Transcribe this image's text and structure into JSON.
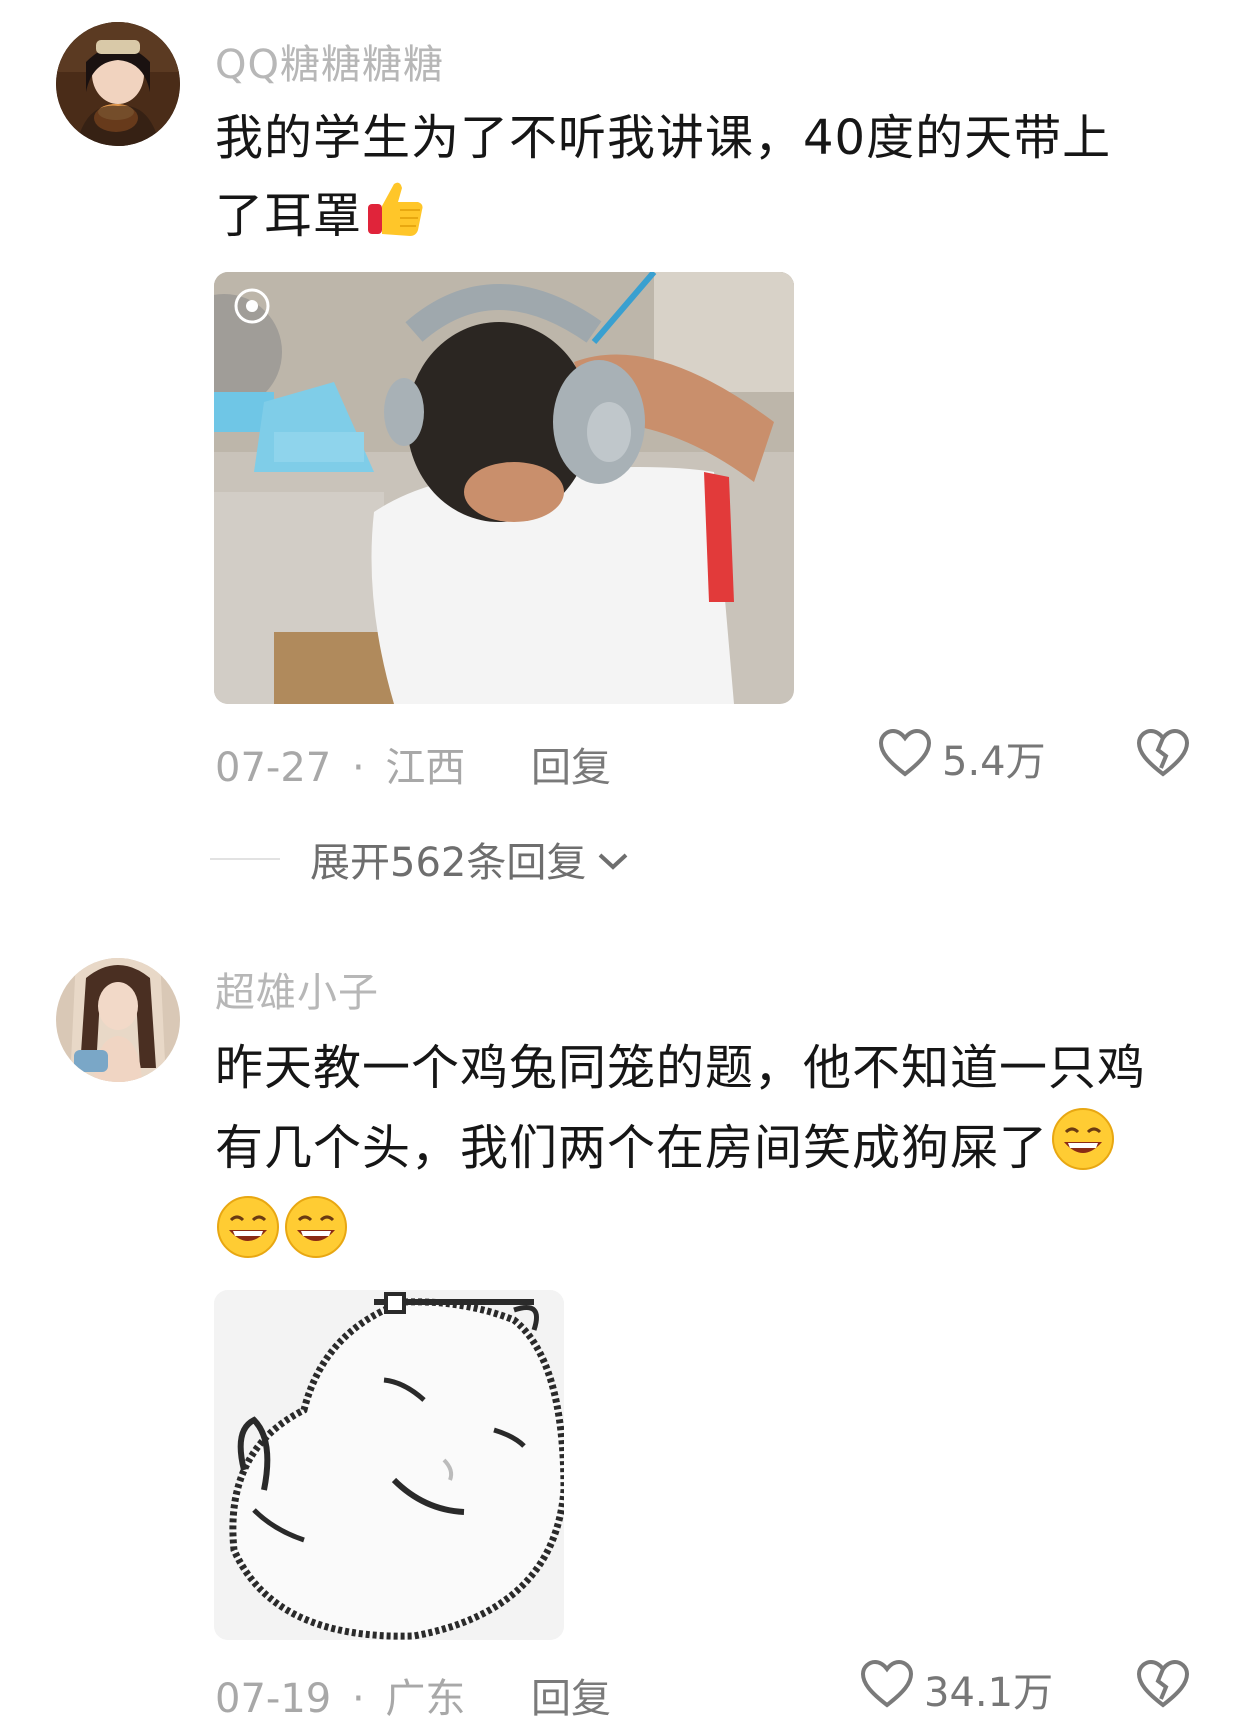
{
  "comments": [
    {
      "username": "QQ糖糖糖糖",
      "content_line1": "我的学生为了不听我讲课，40度的天带上",
      "content_line2": "了耳罩",
      "emoji": "thumbs-up-icon",
      "date": "07-27",
      "location": "江西",
      "separator": "·",
      "reply_label": "回复",
      "likes": "5.4万",
      "expand_label": "展开562条回复"
    },
    {
      "username": "超雄小子",
      "content_line1": "昨天教一个鸡兔同笼的题，他不知道一只鸡",
      "content_line2": "有几个头，我们两个在房间笑成狗屎了",
      "emoji": "grinning-face-icon",
      "date": "07-19",
      "location": "广东",
      "separator": "·",
      "reply_label": "回复",
      "likes": "34.1万"
    }
  ],
  "colors": {
    "username": "#b7b7b7",
    "text": "#161616",
    "meta": "#a8a8a8"
  }
}
